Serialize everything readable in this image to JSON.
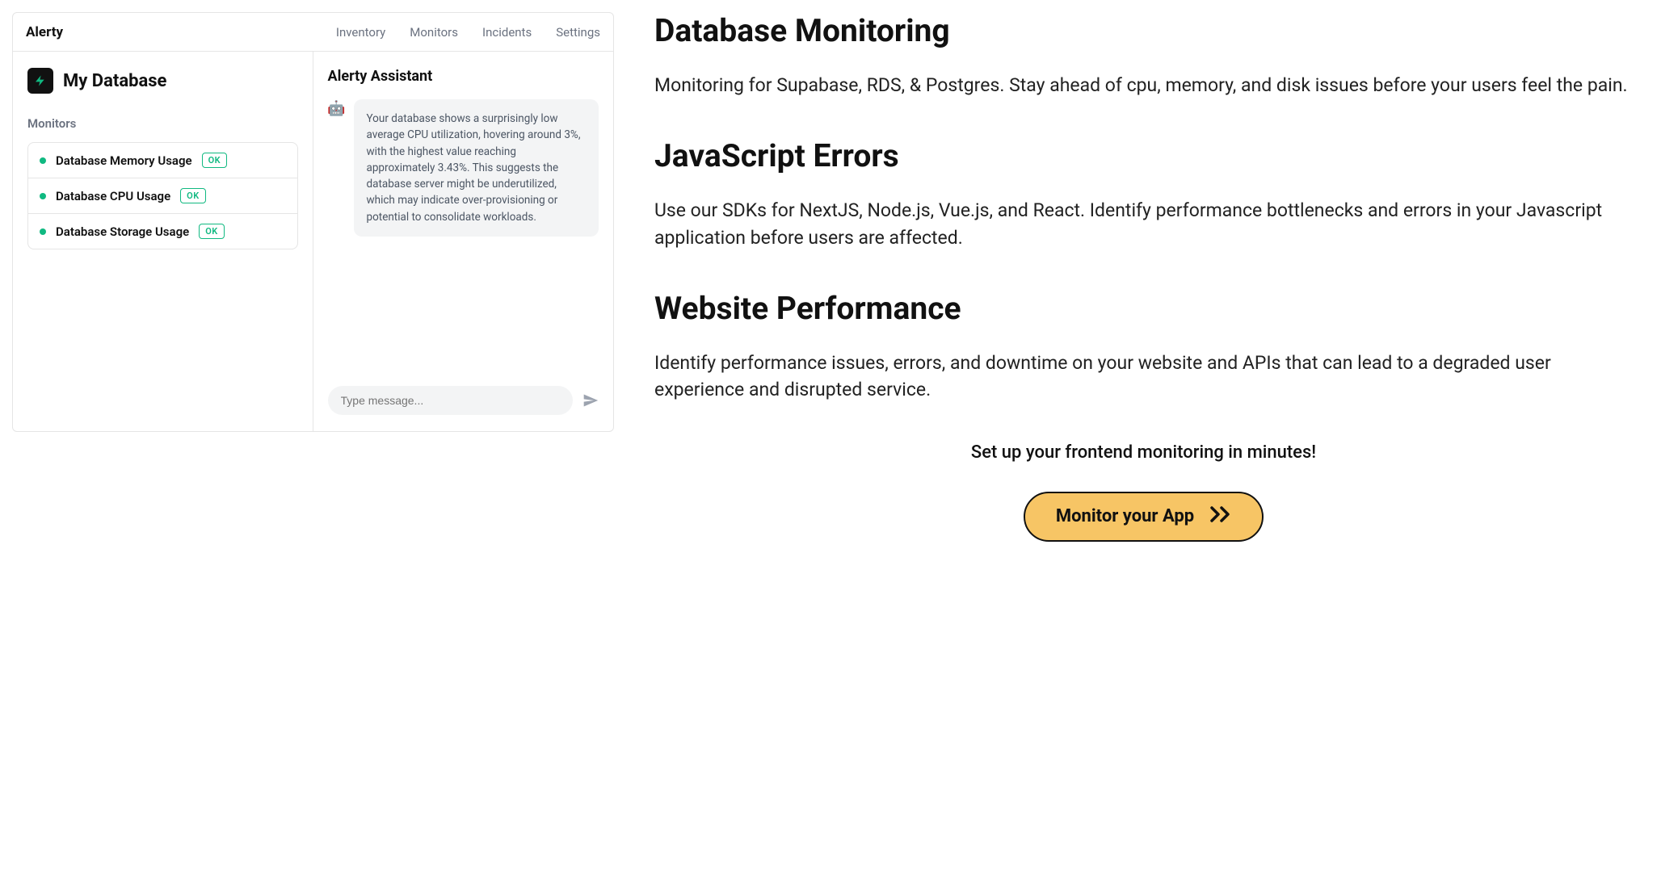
{
  "app": {
    "brand": "Alerty",
    "nav": [
      "Inventory",
      "Monitors",
      "Incidents",
      "Settings"
    ],
    "db_title": "My Database",
    "monitors_label": "Monitors",
    "monitors": [
      {
        "name": "Database Memory Usage",
        "status": "OK"
      },
      {
        "name": "Database CPU Usage",
        "status": "OK"
      },
      {
        "name": "Database Storage Usage",
        "status": "OK"
      }
    ],
    "assistant": {
      "title": "Alerty Assistant",
      "message": "Your database shows a surprisingly low average CPU utilization, hovering around 3%, with the highest value reaching approximately 3.43%. This suggests the database server might be underutilized, which may indicate over-provisioning or potential to consolidate workloads.",
      "input_placeholder": "Type message..."
    }
  },
  "marketing": {
    "sections": [
      {
        "heading": "Database Monitoring",
        "body": "Monitoring for Supabase, RDS, & Postgres. Stay ahead of cpu, memory, and disk issues before your users feel the pain."
      },
      {
        "heading": "JavaScript Errors",
        "body": "Use our SDKs for NextJS, Node.js, Vue.js, and React. Identify performance bottlenecks and errors in your Javascript application before users are affected."
      },
      {
        "heading": "Website Performance",
        "body": "Identify performance issues, errors, and downtime on your website and APIs that can lead to a degraded user experience and disrupted service."
      }
    ],
    "cta_sub": "Set up your frontend monitoring in minutes!",
    "cta_label": "Monitor your App"
  },
  "colors": {
    "ok_green": "#10b981",
    "cta_bg": "#f7c565"
  }
}
